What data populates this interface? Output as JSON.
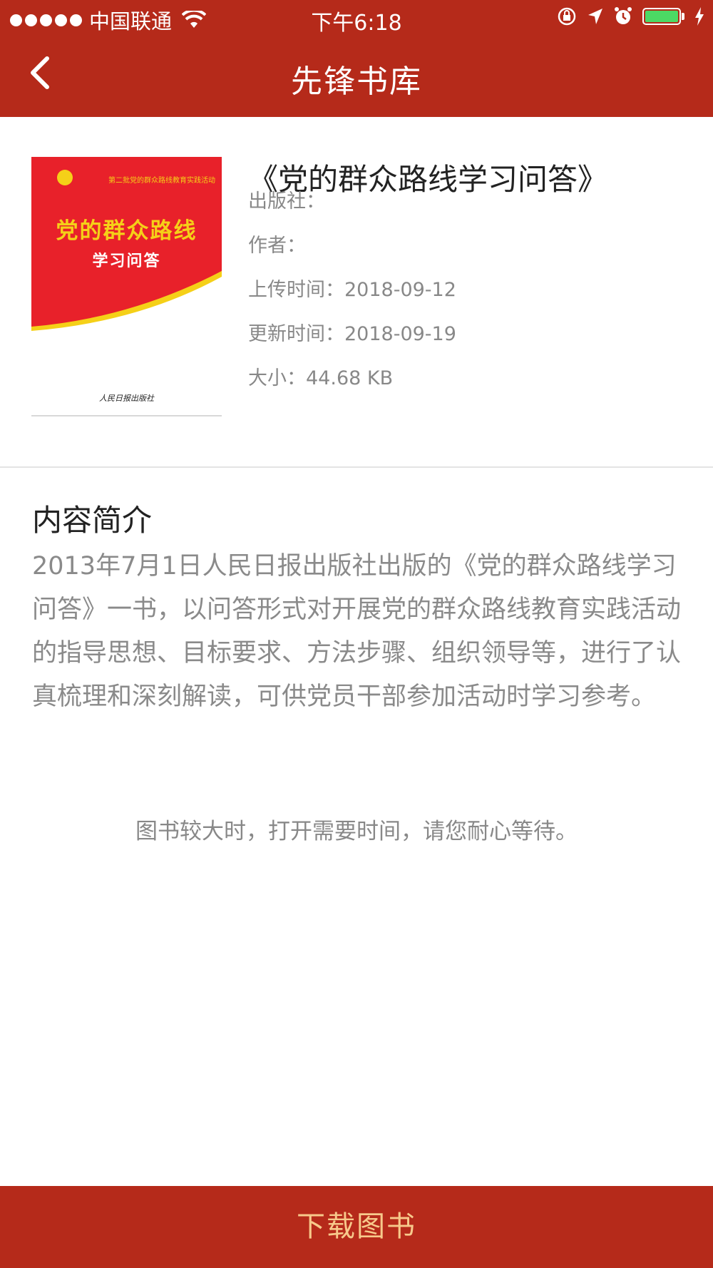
{
  "status_bar": {
    "carrier": "中国联通",
    "time": "下午6:18"
  },
  "nav": {
    "title": "先锋书库",
    "back_icon": "chevron-left-icon"
  },
  "book": {
    "title": "《党的群众路线学习问答》",
    "cover": {
      "title_line1": "党的群众路线",
      "title_line2": "学习问答",
      "series": "第二批党的群众路线教育实践活动",
      "publisher_mark": "人民日报出版社"
    },
    "meta": [
      {
        "label": "出版社：",
        "value": ""
      },
      {
        "label": "作者：",
        "value": ""
      },
      {
        "label": "上传时间：",
        "value": "2018-09-12"
      },
      {
        "label": "更新时间：",
        "value": "2018-09-19"
      },
      {
        "label": "大小：",
        "value": "44.68 KB"
      }
    ]
  },
  "intro": {
    "heading": "内容简介",
    "text": "2013年7月1日人民日报出版社出版的《党的群众路线学习问答》一书，以问答形式对开展党的群众路线教育实践活动的指导思想、目标要求、方法步骤、组织领导等，进行了认真梳理和深刻解读，可供党员干部参加活动时学习参考。"
  },
  "hint": "图书较大时，打开需要时间，请您耐心等待。",
  "download_button": "下载图书",
  "colors": {
    "header": "#b52a1a",
    "button_text": "#f7c98b",
    "battery": "#4cd964"
  }
}
